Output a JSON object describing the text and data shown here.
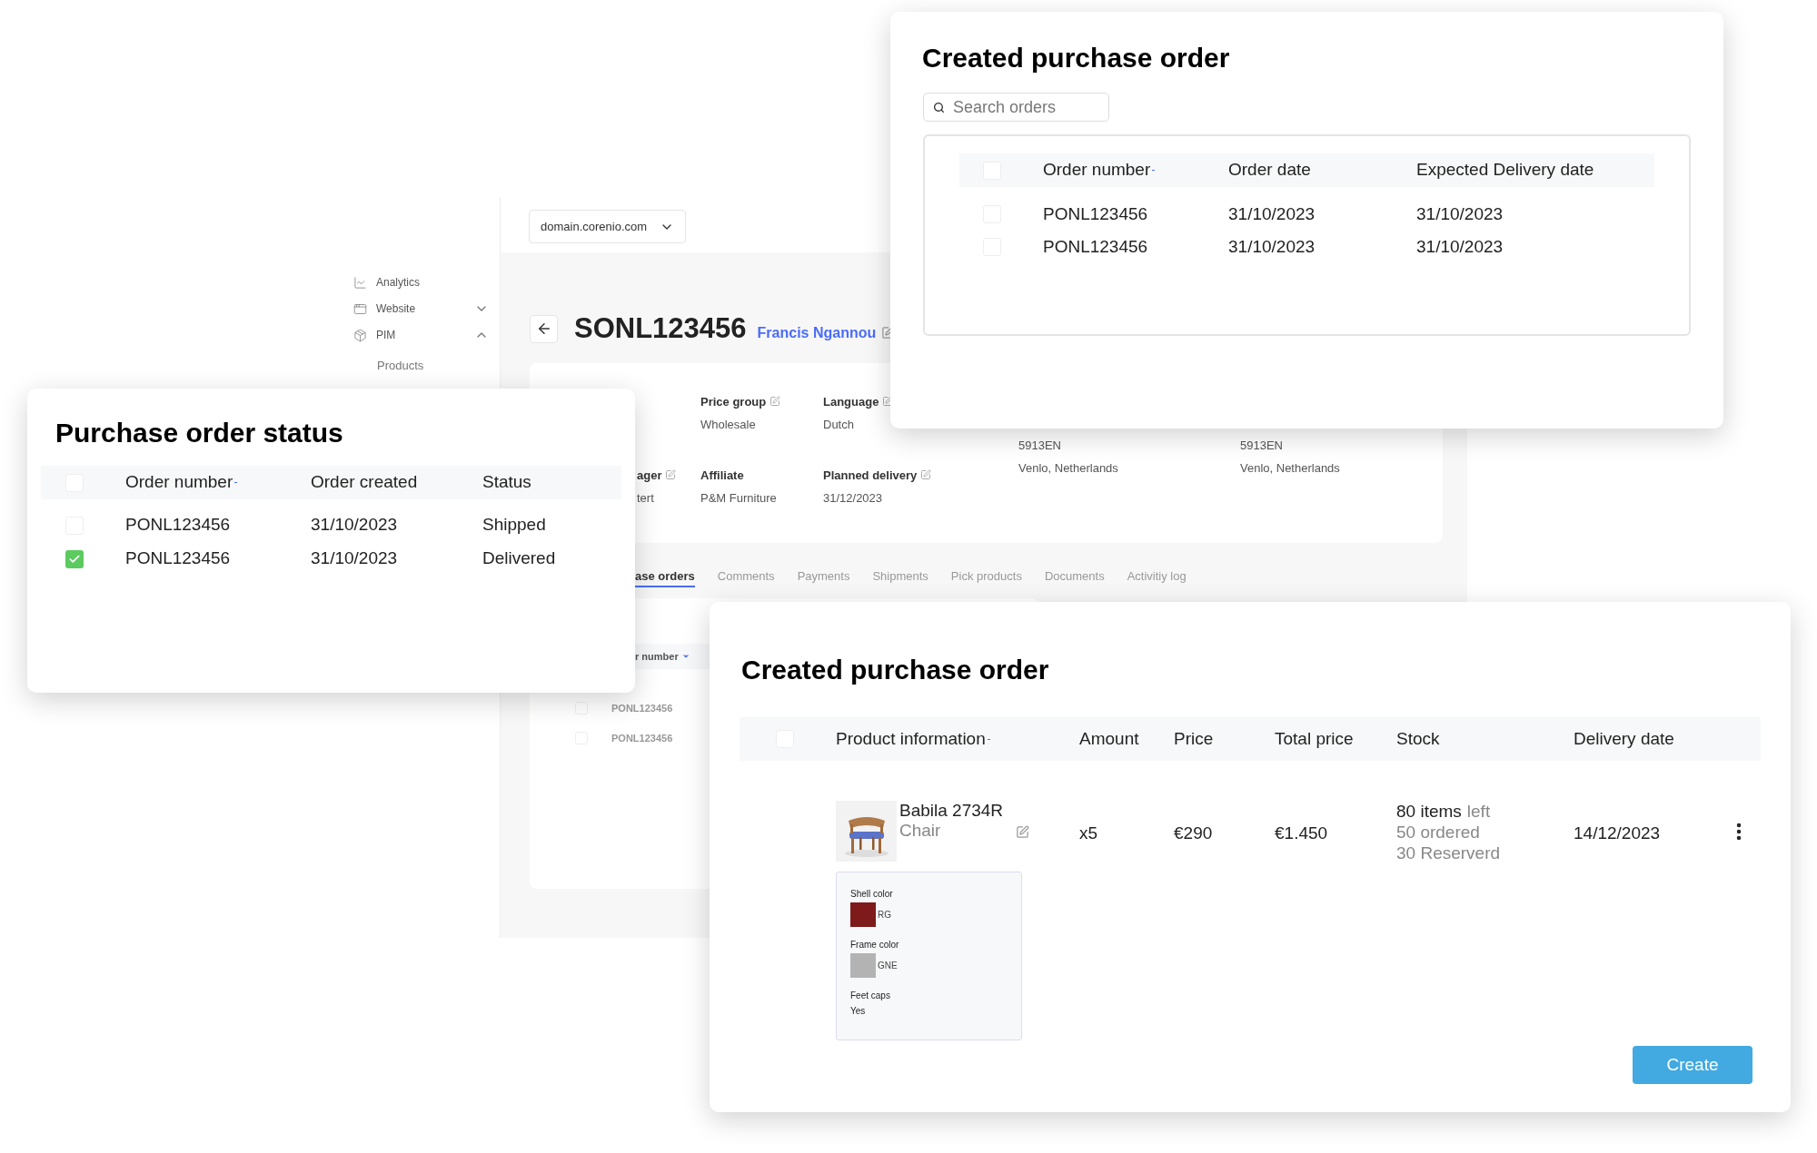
{
  "background_app": {
    "sidebar": {
      "items": [
        {
          "kind": "link",
          "label": "Analytics"
        },
        {
          "kind": "group",
          "label": "Website",
          "expanded": false
        },
        {
          "kind": "group",
          "label": "PIM",
          "expanded": true,
          "children": [
            {
              "label": "Products"
            }
          ]
        }
      ]
    },
    "domain_select": {
      "value": "domain.corenio.com"
    },
    "order": {
      "number": "SONL123456",
      "customer": "Francis Ngannou"
    },
    "details": {
      "fields": [
        {
          "label": "Price group",
          "value": "Wholesale",
          "editable": true
        },
        {
          "label": "Language",
          "value": "Dutch",
          "editable": true
        },
        {
          "label": "ager",
          "value": "tert",
          "editable": true
        },
        {
          "label": "Affiliate",
          "value": "P&M Furniture",
          "editable": false
        },
        {
          "label": "Planned delivery",
          "value": "31/12/2023",
          "editable": true
        }
      ],
      "addresses": [
        {
          "lines": [
            "5913EN",
            "Venlo, Netherlands"
          ]
        },
        {
          "lines": [
            "5913EN",
            "Venlo, Netherlands"
          ]
        }
      ]
    },
    "tabs": [
      {
        "label": "ase orders",
        "selected": true
      },
      {
        "label": "Comments",
        "selected": false
      },
      {
        "label": "Payments",
        "selected": false
      },
      {
        "label": "Shipments",
        "selected": false
      },
      {
        "label": "Pick products",
        "selected": false
      },
      {
        "label": "Documents",
        "selected": false
      },
      {
        "label": "Activitiy log",
        "selected": false
      }
    ],
    "orders_table": {
      "column": "r number",
      "rows": [
        {
          "checked": false,
          "number": "PONL123456"
        },
        {
          "checked": false,
          "number": "PONL123456"
        }
      ]
    }
  },
  "status_panel": {
    "title": "Purchase order status",
    "header_checked": false,
    "columns": [
      {
        "label": "Order number",
        "sorted": true
      },
      {
        "label": "Order created",
        "sorted": false
      },
      {
        "label": "Status",
        "sorted": false
      }
    ],
    "rows": [
      {
        "checked": false,
        "cells": [
          "PONL123456",
          "31/10/2023",
          "Shipped"
        ]
      },
      {
        "checked": true,
        "cells": [
          "PONL123456",
          "31/10/2023",
          "Delivered"
        ]
      }
    ]
  },
  "created_panel": {
    "title": "Created purchase order",
    "search": {
      "placeholder": "Search orders"
    },
    "header_checked": false,
    "columns": [
      {
        "label": "Order number",
        "sorted": true
      },
      {
        "label": "Order date",
        "sorted": false
      },
      {
        "label": "Expected Delivery date",
        "sorted": false
      }
    ],
    "rows": [
      {
        "checked": false,
        "cells": [
          "PONL123456",
          "31/10/2023",
          "31/10/2023"
        ]
      },
      {
        "checked": false,
        "cells": [
          "PONL123456",
          "31/10/2023",
          "31/10/2023"
        ]
      }
    ]
  },
  "product_panel": {
    "title": "Created purchase order",
    "header_checked": false,
    "columns": [
      {
        "label": "Product information",
        "sorted": true
      },
      {
        "label": "Amount",
        "sorted": false
      },
      {
        "label": "Price",
        "sorted": false
      },
      {
        "label": "Total price",
        "sorted": false
      },
      {
        "label": "Stock",
        "sorted": false
      },
      {
        "label": "Delivery date",
        "sorted": false
      }
    ],
    "rows": [
      {
        "name": "Babila 2734R",
        "type": "Chair",
        "amount": "x5",
        "price": "€290",
        "total": "€1.450",
        "stock": {
          "count": "80 items",
          "count_suffix": "left",
          "ordered": "50 ordered",
          "reserved": "30 Reserverd"
        },
        "delivery": "14/12/2023",
        "options": [
          {
            "kind": "swatch",
            "label": "Shell color",
            "color": "#7f1a1a",
            "code": "RG"
          },
          {
            "kind": "swatch",
            "label": "Frame color",
            "color": "#b3b3b3",
            "code": "GNE"
          },
          {
            "kind": "text",
            "label": "Feet caps",
            "value": "Yes"
          }
        ]
      }
    ],
    "button": "Create"
  }
}
